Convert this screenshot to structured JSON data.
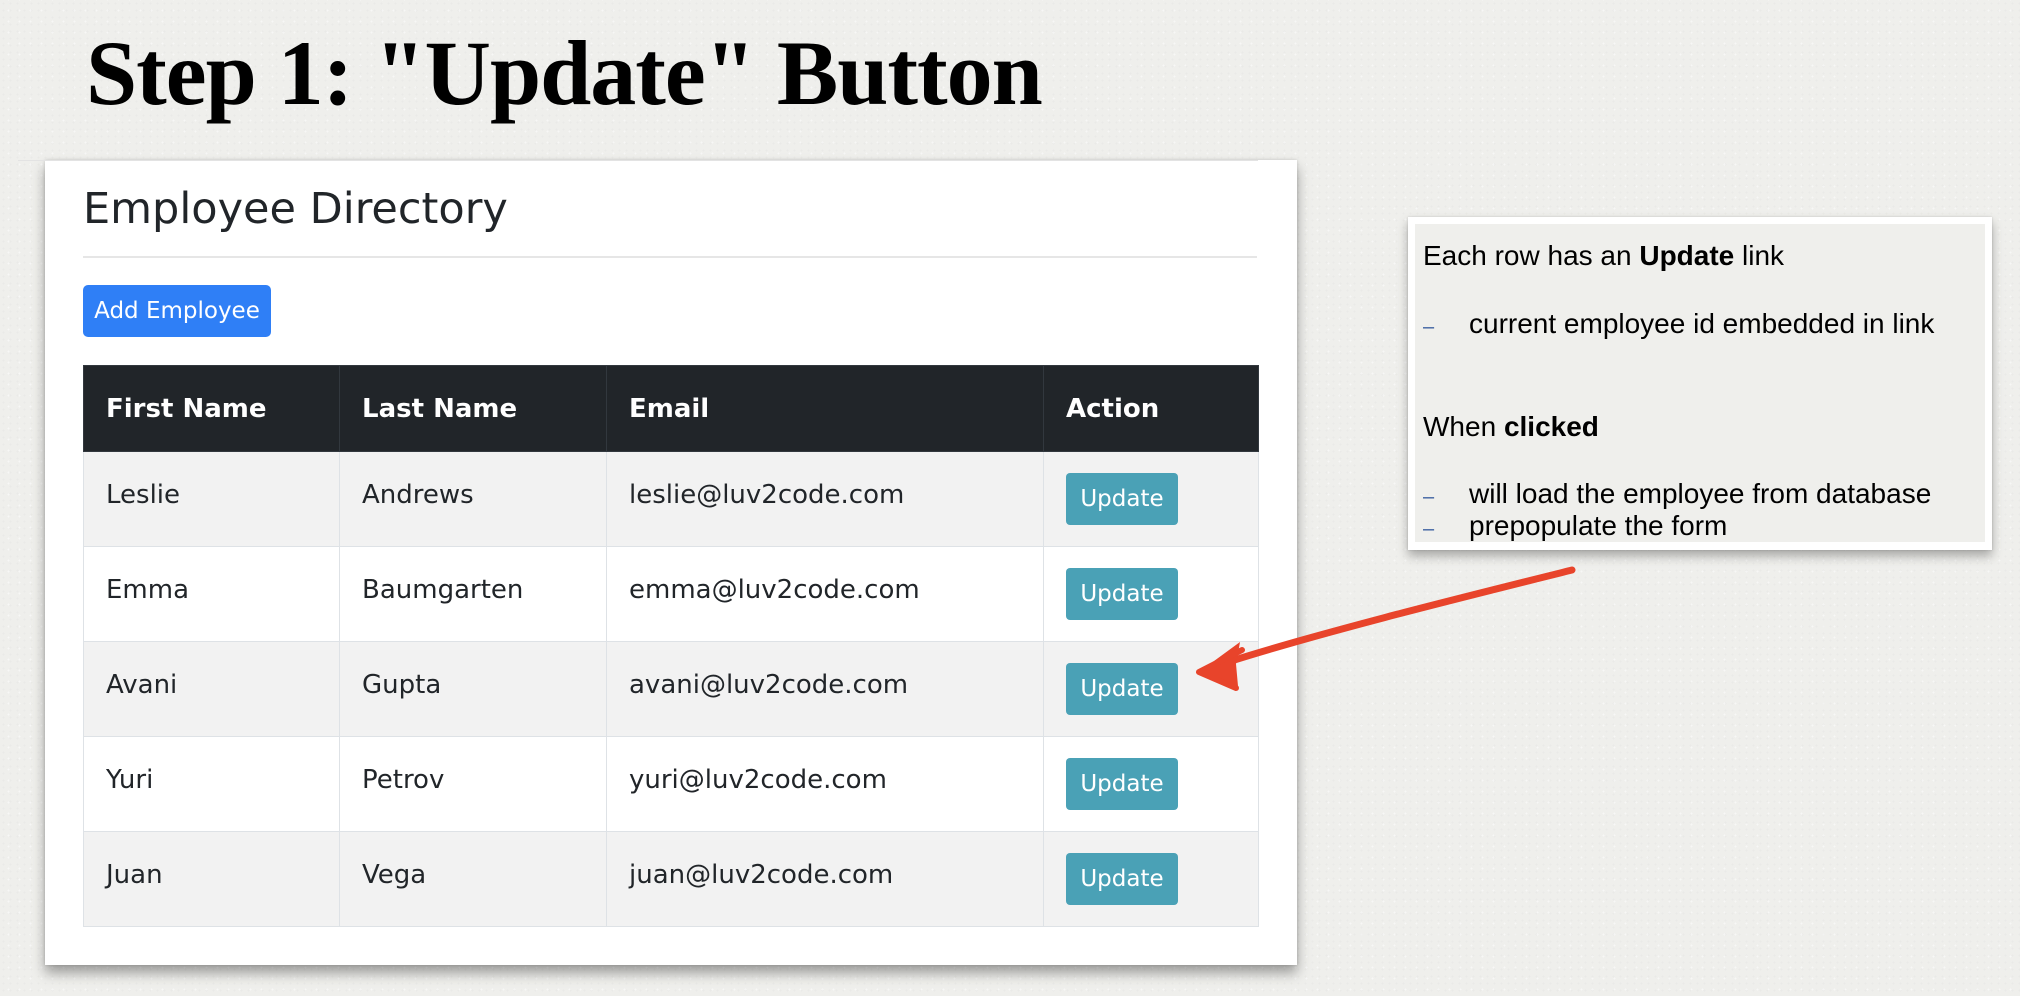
{
  "slide": {
    "title": "Step 1: \"Update\" Button"
  },
  "app": {
    "page_title": "Employee Directory",
    "add_button_label": "Add Employee",
    "columns": [
      "First Name",
      "Last Name",
      "Email",
      "Action"
    ],
    "update_label": "Update",
    "rows": [
      {
        "first": "Leslie",
        "last": "Andrews",
        "email": "leslie@luv2code.com"
      },
      {
        "first": "Emma",
        "last": "Baumgarten",
        "email": "emma@luv2code.com"
      },
      {
        "first": "Avani",
        "last": "Gupta",
        "email": "avani@luv2code.com"
      },
      {
        "first": "Yuri",
        "last": "Petrov",
        "email": "yuri@luv2code.com"
      },
      {
        "first": "Juan",
        "last": "Vega",
        "email": "juan@luv2code.com"
      }
    ]
  },
  "callout": {
    "line1_pre": "Each row has an ",
    "line1_bold": "Update",
    "line1_post": " link",
    "bullet1": "current employee id embedded in link",
    "line2_pre": "When ",
    "line2_bold": "clicked",
    "bullet2": "will load the employee from database",
    "bullet3": "prepopulate the form"
  },
  "colors": {
    "header_bg": "#212529",
    "add_button": "#2f7ff6",
    "update_button": "#4aa1b6",
    "arrow": "#e8442b"
  }
}
